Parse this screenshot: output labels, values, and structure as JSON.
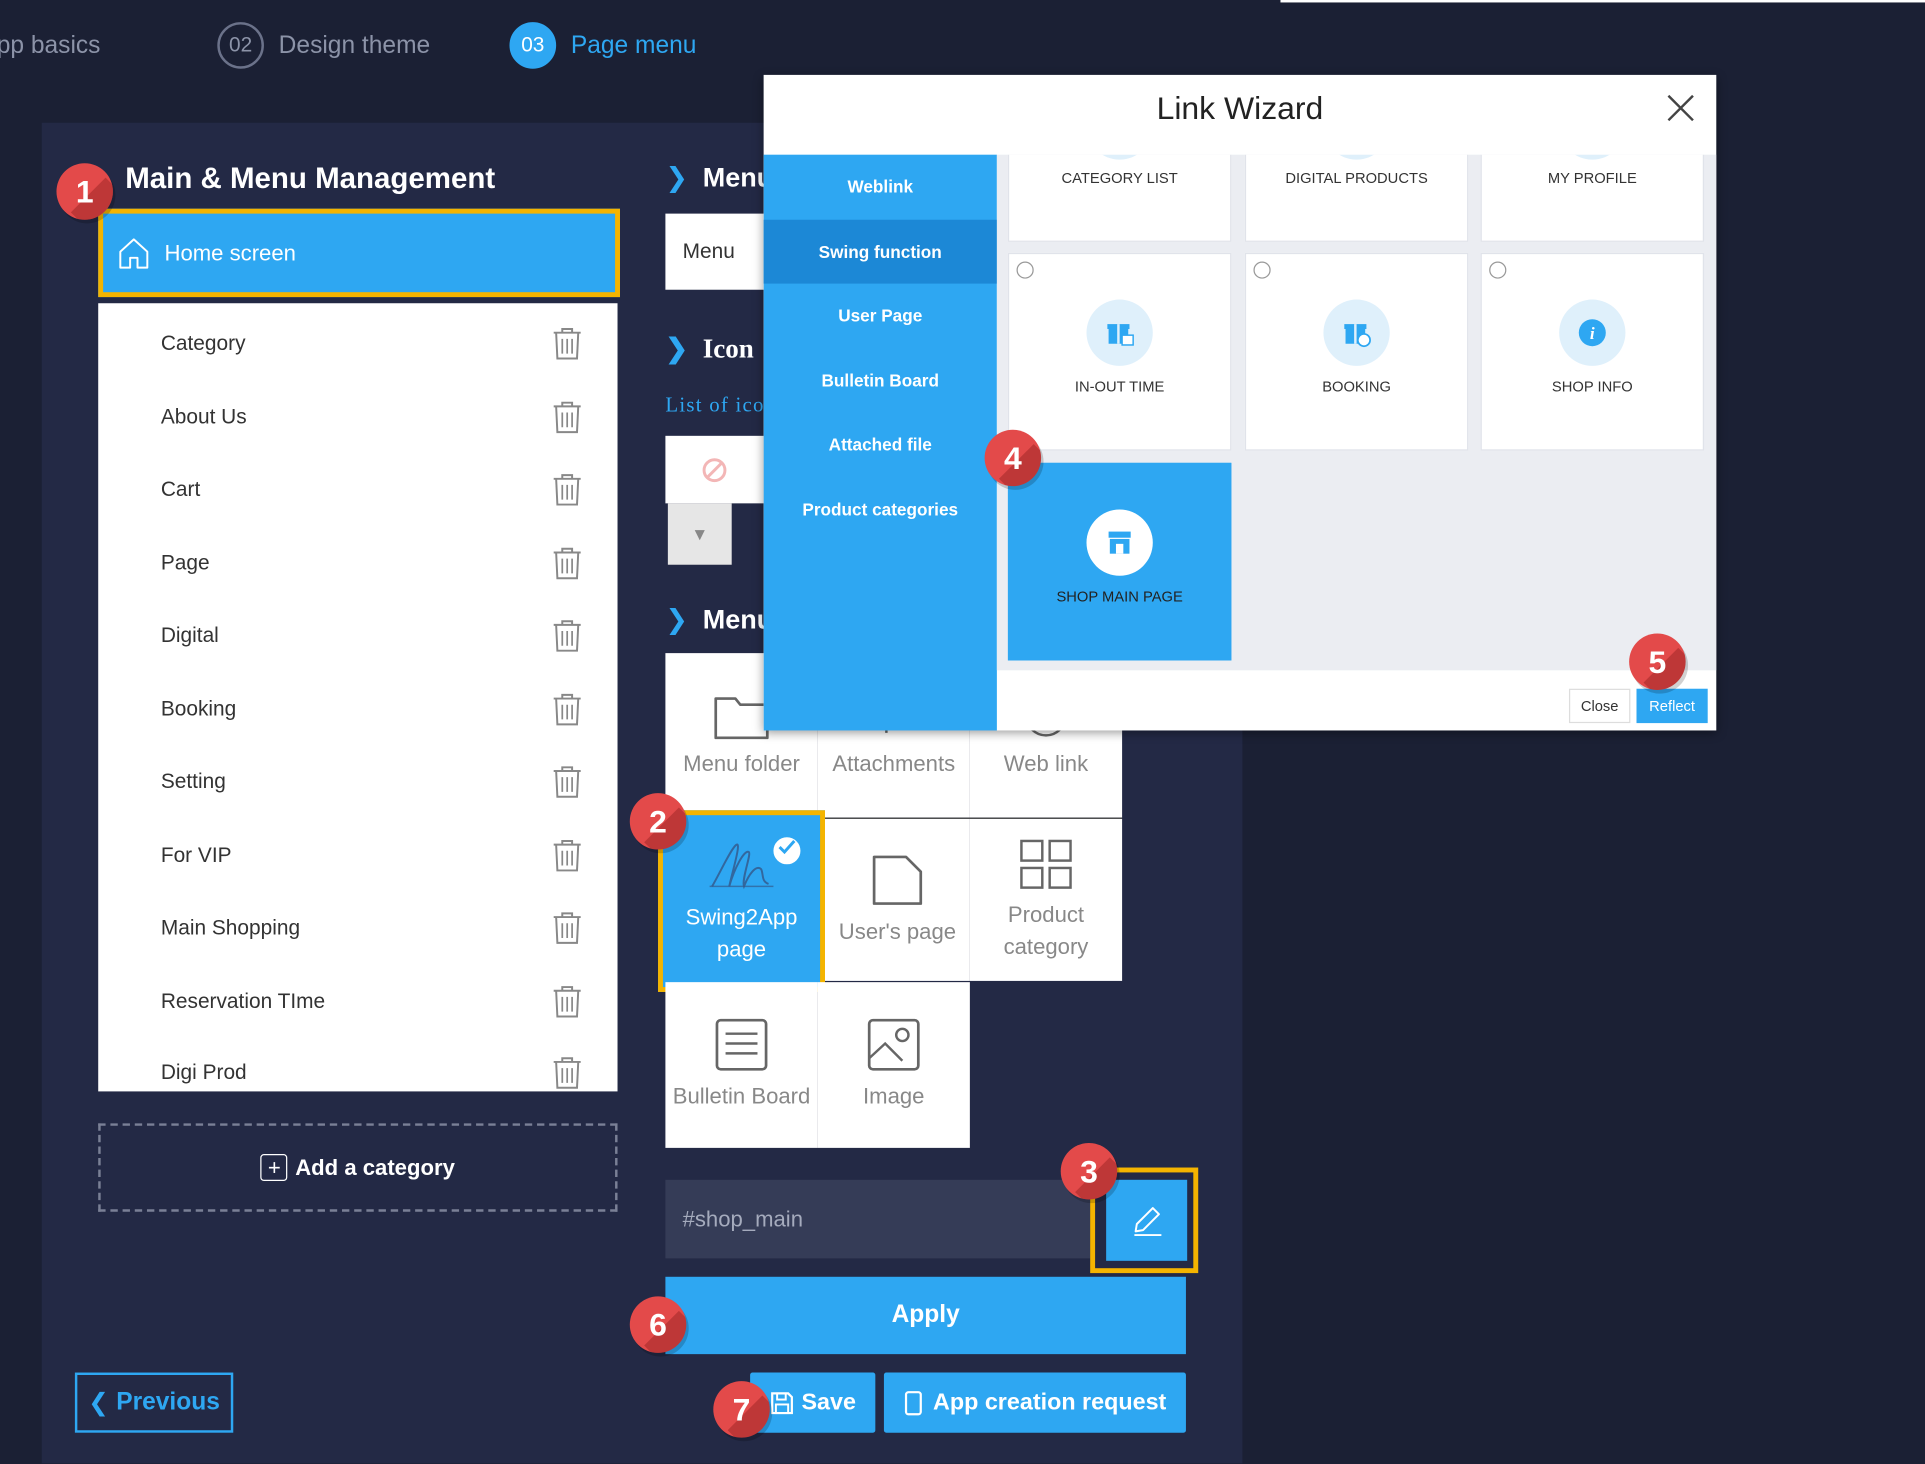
{
  "stepper": [
    {
      "num": "",
      "label": "App basics"
    },
    {
      "num": "02",
      "label": "Design theme"
    },
    {
      "num": "03",
      "label": "Page menu"
    }
  ],
  "left": {
    "title": "Main & Menu Management",
    "home_label": "Home screen",
    "items": [
      "Category",
      "About Us",
      "Cart",
      "Page",
      "Digital",
      "Booking",
      "Setting",
      "For VIP",
      "Main Shopping",
      "Reservation TIme",
      "Digi Prod"
    ],
    "add_category": "Add a category",
    "previous": "Previous"
  },
  "right": {
    "menu_heading": "Menu",
    "menu_input_value": "Menu",
    "icon_heading": "Icon",
    "icon_list_label": "List of ico",
    "menu_type_heading": "Menu",
    "tiles": {
      "menu_folder": "Menu folder",
      "attachments": "Attachments",
      "web_link": "Web link",
      "swing2app_line1": "Swing2App",
      "swing2app_line2": "page",
      "users_page": "User's page",
      "product_line1": "Product",
      "product_line2": "category",
      "bulletin_board": "Bulletin Board",
      "image": "Image"
    },
    "link_value": "#shop_main",
    "apply": "Apply",
    "save": "Save",
    "app_request": "App creation request"
  },
  "modal": {
    "title": "Link Wizard",
    "side_items": [
      "Weblink",
      "Swing function",
      "User Page",
      "Bulletin Board",
      "Attached file",
      "Product categories"
    ],
    "active_side": "Swing function",
    "cards_top": [
      "CATEGORY LIST",
      "DIGITAL PRODUCTS",
      "MY PROFILE"
    ],
    "cards_mid": [
      "IN-OUT TIME",
      "BOOKING",
      "SHOP INFO"
    ],
    "card_selected": "SHOP MAIN PAGE",
    "close": "Close",
    "reflect": "Reflect"
  },
  "badges": [
    "1",
    "2",
    "3",
    "4",
    "5",
    "6",
    "7"
  ],
  "colors": {
    "accent": "#2ea7f2",
    "highlight": "#f4b400",
    "badge": "#e34a4a",
    "background": "#1b2034"
  }
}
